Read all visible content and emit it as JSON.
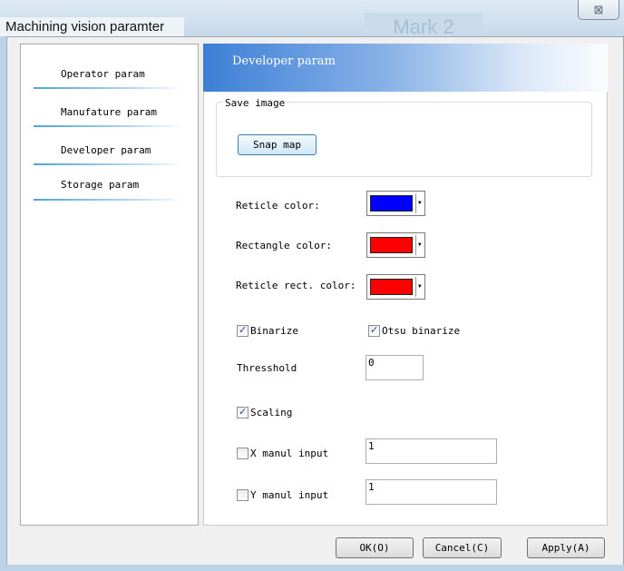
{
  "window": {
    "title": "Machining vision paramter",
    "background_tab": "Mark 2",
    "close_icon": "close-x-icon",
    "close_glyph": "⊠"
  },
  "nav": {
    "items": [
      {
        "label": "Operator param"
      },
      {
        "label": "Manufature param"
      },
      {
        "label": "Developer param"
      },
      {
        "label": "Storage param"
      }
    ]
  },
  "header": {
    "title": "Developer param"
  },
  "save_image": {
    "legend": "Save image",
    "snap_button": "Snap map"
  },
  "colors": {
    "reticle_label": "Reticle color:",
    "reticle_value": "#0000ff",
    "rectangle_label": "Rectangle color:",
    "rectangle_value": "#ff0000",
    "reticle_rect_label": "Reticle rect. color:",
    "reticle_rect_value": "#ff0000"
  },
  "options": {
    "binarize": {
      "label": "Binarize",
      "checked": true
    },
    "otsu": {
      "label": "Otsu binarize",
      "checked": true
    },
    "threshold": {
      "label": "Thresshold",
      "value": "0"
    },
    "scaling": {
      "label": "Scaling",
      "checked": true
    },
    "x_manual": {
      "label": "X manul input",
      "checked": false,
      "value": "1"
    },
    "y_manual": {
      "label": "Y manul input",
      "checked": false,
      "value": "1"
    }
  },
  "buttons": {
    "ok": "OK(O)",
    "cancel": "Cancel(C)",
    "apply": "Apply(A)"
  }
}
